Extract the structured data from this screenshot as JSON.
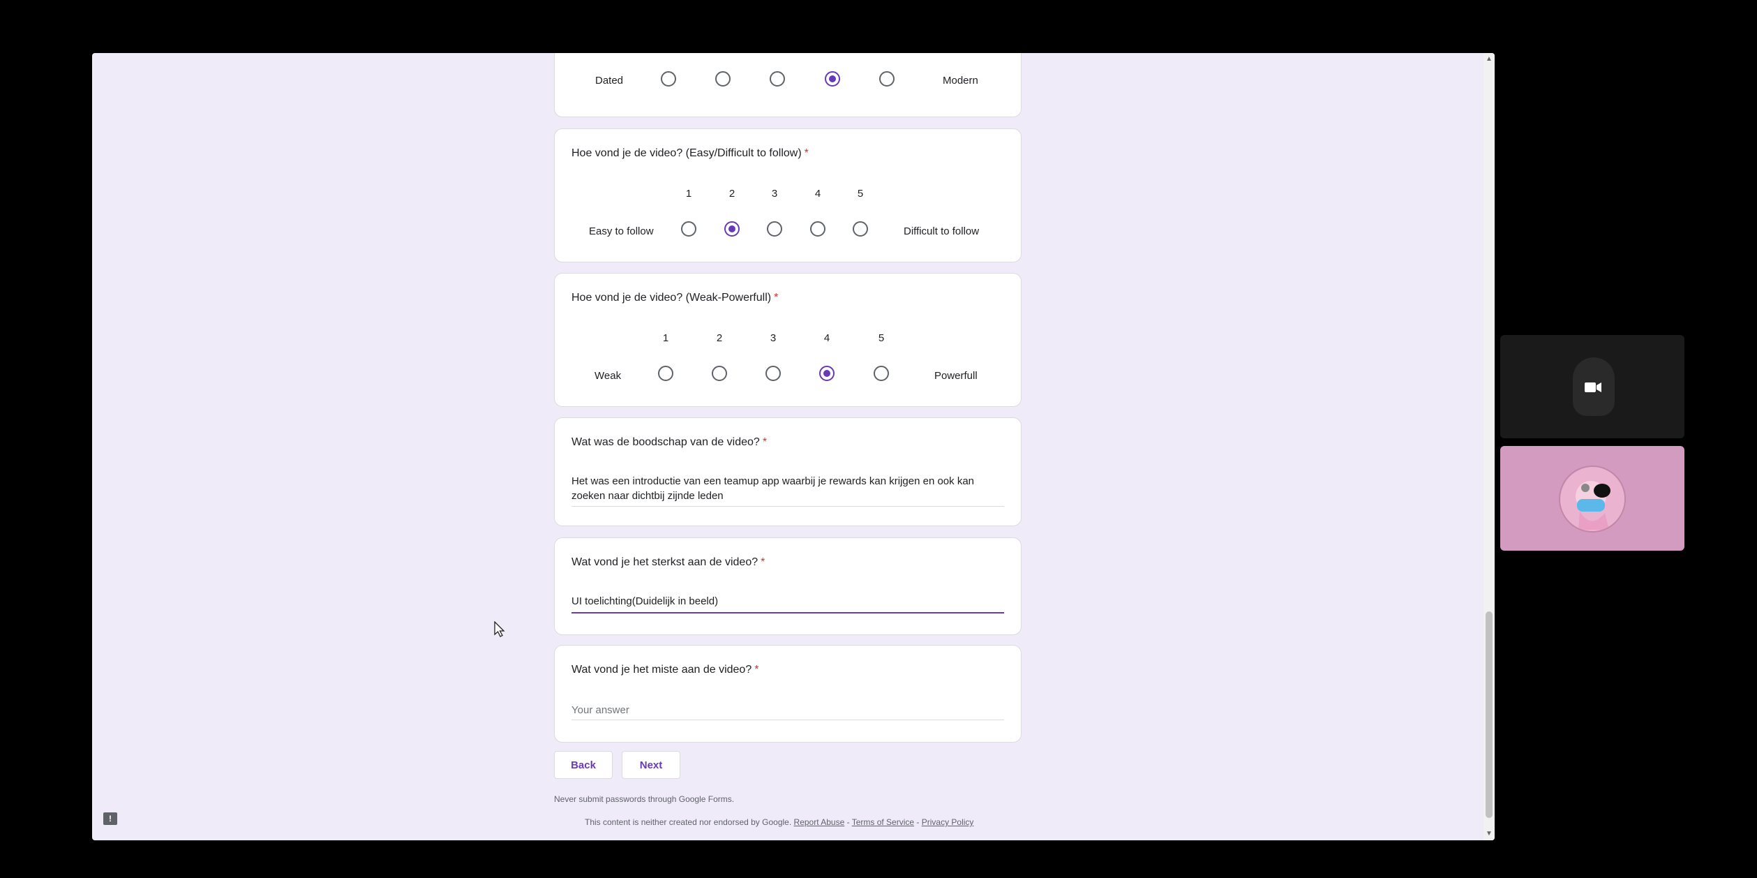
{
  "form": {
    "q0": {
      "left_label": "Dated",
      "right_label": "Modern",
      "selected": 4
    },
    "q1": {
      "title": "Hoe vond je de video? (Easy/Difficult to follow)",
      "required_mark": "*",
      "scale": [
        "1",
        "2",
        "3",
        "4",
        "5"
      ],
      "left_label": "Easy to follow",
      "right_label": "Difficult to follow",
      "selected": 2
    },
    "q2": {
      "title": "Hoe vond je de video? (Weak-Powerfull)",
      "required_mark": "*",
      "scale": [
        "1",
        "2",
        "3",
        "4",
        "5"
      ],
      "left_label": "Weak",
      "right_label": "Powerfull",
      "selected": 4
    },
    "q3": {
      "title": "Wat was de boodschap van de video?",
      "required_mark": "*",
      "answer": "Het was een introductie van een teamup app waarbij je rewards kan krijgen en ook kan zoeken naar dichtbij zijnde leden"
    },
    "q4": {
      "title": "Wat vond je het sterkst aan de video?",
      "required_mark": "*",
      "answer": "UI toelichting(Duidelijk in beeld)"
    },
    "q5": {
      "title": "Wat vond je het miste aan de video?",
      "required_mark": "*",
      "placeholder": "Your answer"
    },
    "buttons": {
      "back": "Back",
      "next": "Next"
    },
    "footer": {
      "password_notice": "Never submit passwords through Google Forms.",
      "disclaimer": "This content is neither created nor endorsed by Google.",
      "report_abuse": "Report Abuse",
      "separator": " - ",
      "terms": "Terms of Service",
      "privacy": "Privacy Policy"
    }
  },
  "icons": {
    "feedback": "feedback-icon",
    "camera_off": "camera-off-icon",
    "cursor": "mouse-cursor-icon"
  },
  "colors": {
    "accent": "#673ab7",
    "background": "#f0ebf8",
    "required": "#d93025"
  }
}
